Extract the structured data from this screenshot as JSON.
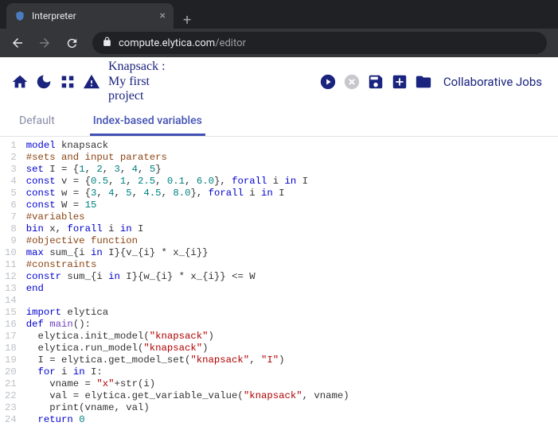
{
  "chrome": {
    "tab_title": "Interpreter",
    "url_host": "compute.elytica.com",
    "url_path": "/editor"
  },
  "header": {
    "project_title": "Knapsack :\nMy first\nproject",
    "collab_label": "Collaborative Jobs"
  },
  "tabs": {
    "default": "Default",
    "indexvars": "Index-based variables"
  },
  "code": {
    "lines": [
      {
        "n": 1,
        "t": "model",
        "h": "<span class='kw'>model</span> knapsack"
      },
      {
        "n": 2,
        "t": "comment",
        "h": "<span class='cm'>#sets and input paraters</span>"
      },
      {
        "n": 3,
        "t": "set",
        "h": "<span class='kw'>set</span> I = {<span class='num'>1</span>, <span class='num'>2</span>, <span class='num'>3</span>, <span class='num'>4</span>, <span class='num'>5</span>}"
      },
      {
        "n": 4,
        "t": "const",
        "h": "<span class='kw'>const</span> v = {<span class='num'>0.5</span>, <span class='num'>1</span>, <span class='num'>2.5</span>, <span class='num'>0.1</span>, <span class='num'>6.0</span>}, <span class='kw'>forall</span> i <span class='kw'>in</span> I"
      },
      {
        "n": 5,
        "t": "const",
        "h": "<span class='kw'>const</span> w = {<span class='num'>3</span>, <span class='num'>4</span>, <span class='num'>5</span>, <span class='num'>4.5</span>, <span class='num'>8.0</span>}, <span class='kw'>forall</span> i <span class='kw'>in</span> I"
      },
      {
        "n": 6,
        "t": "const",
        "h": "<span class='kw'>const</span> W = <span class='num'>15</span>"
      },
      {
        "n": 7,
        "t": "comment",
        "h": "<span class='cm'>#variables</span>"
      },
      {
        "n": 8,
        "t": "bin",
        "h": "<span class='kw'>bin</span> x, <span class='kw'>forall</span> i <span class='kw'>in</span> I"
      },
      {
        "n": 9,
        "t": "comment",
        "h": "<span class='cm'>#objective function</span>"
      },
      {
        "n": 10,
        "t": "max",
        "h": "<span class='kw'>max</span> sum_{i <span class='kw'>in</span> I}{v_{i} * x_{i}}"
      },
      {
        "n": 11,
        "t": "comment",
        "h": "<span class='cm'>#constraints</span>"
      },
      {
        "n": 12,
        "t": "constr",
        "h": "<span class='kw'>constr</span> sum_{i <span class='kw'>in</span> I}{w_{i} * x_{i}} &lt;= W"
      },
      {
        "n": 13,
        "t": "end",
        "h": "<span class='kw'>end</span>"
      },
      {
        "n": 14,
        "t": "blank",
        "h": ""
      },
      {
        "n": 15,
        "t": "import",
        "h": "<span class='kw'>import</span> elytica"
      },
      {
        "n": 16,
        "t": "def",
        "h": "<span class='kw'>def</span> <span class='fn'>main</span>():"
      },
      {
        "n": 17,
        "t": "call",
        "h": "  elytica.init_model(<span class='str'>\"knapsack\"</span>)"
      },
      {
        "n": 18,
        "t": "call",
        "h": "  elytica.run_model(<span class='str'>\"knapsack\"</span>)"
      },
      {
        "n": 19,
        "t": "assign",
        "h": "  I = elytica.get_model_set(<span class='str'>\"knapsack\"</span>, <span class='str'>\"I\"</span>)"
      },
      {
        "n": 20,
        "t": "for",
        "h": "  <span class='kw'>for</span> i <span class='kw'>in</span> I:"
      },
      {
        "n": 21,
        "t": "assign",
        "h": "    vname = <span class='str'>\"x\"</span>+str(i)"
      },
      {
        "n": 22,
        "t": "assign",
        "h": "    val = elytica.get_variable_value(<span class='str'>\"knapsack\"</span>, vname)"
      },
      {
        "n": 23,
        "t": "call",
        "h": "    print(vname, val)"
      },
      {
        "n": 24,
        "t": "return",
        "h": "  <span class='kw'>return</span> <span class='num'>0</span>"
      }
    ]
  }
}
